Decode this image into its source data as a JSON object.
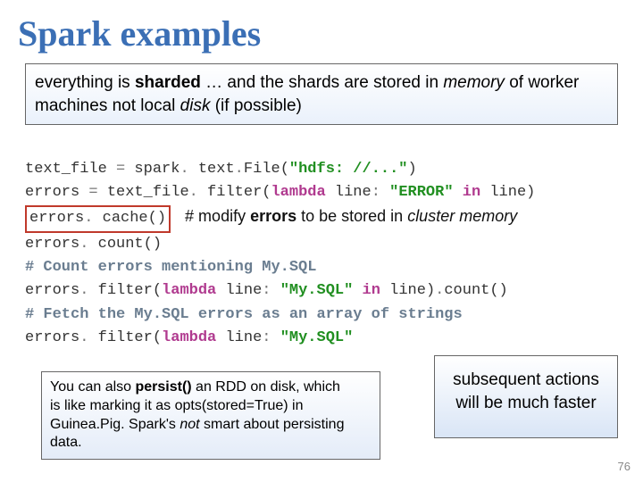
{
  "title": "Spark examples",
  "intro": {
    "pre": "everything is ",
    "sharded": "sharded",
    "mid1": " … and the shards are stored in ",
    "memory": "memory",
    "mid2": " of worker machines not local ",
    "disk": "disk",
    "post": " (if possible)"
  },
  "code": {
    "l1_a": "text_file ",
    "l1_eq": "=",
    "l1_b": " spark",
    "l1_dot1": ".",
    "l1_c": " text",
    "l1_dot2": ".",
    "l1_d": "File",
    "l1_p1": "(",
    "l1_str": "\"hdfs: //...\"",
    "l1_p2": ")",
    "l2_a": "errors ",
    "l2_eq": "=",
    "l2_b": " text_file",
    "l2_dot1": ".",
    "l2_c": " filter",
    "l2_p1": "(",
    "l2_lam": "lambda",
    "l2_d": " line",
    "l2_col": ":",
    "l2_sp": " ",
    "l2_str": "\"ERROR\"",
    "l2_in": " in ",
    "l2_e": "line",
    "l2_p2": ")",
    "l3_a": "errors",
    "l3_dot": ".",
    "l3_b": " cache",
    "l3_p": "()",
    "l4_a": "errors",
    "l4_dot": ".",
    "l4_b": " count",
    "l4_p": "()",
    "l5": "# Count errors mentioning My.SQL",
    "l6_a": "errors",
    "l6_dot1": ".",
    "l6_b": " filter",
    "l6_p1": "(",
    "l6_lam": "lambda",
    "l6_c": " line",
    "l6_col": ":",
    "l6_sp": " ",
    "l6_str": "\"My.SQL\"",
    "l6_in": " in ",
    "l6_d": "line",
    "l6_p2": ")",
    "l6_dot2": ".",
    "l6_e": "count",
    "l6_p3": "()",
    "l7": "# Fetch the My.SQL errors as an array of strings",
    "l8_a": "errors",
    "l8_dot1": ".",
    "l8_b": " filter",
    "l8_p1": "(",
    "l8_lam": "lambda",
    "l8_c": " line",
    "l8_col": ":",
    "l8_sp": " ",
    "l8_str": "\"My.SQL\""
  },
  "inline_annot": {
    "pre": "# modify ",
    "errors": "errors",
    "mid": " to be stored in ",
    "cluster": "cluster memory"
  },
  "persist": {
    "a": "You can also ",
    "persist": "persist()",
    "b": " an RDD on disk, which",
    "c": "is like marking it as opts(stored=True) in Guinea.Pig. Spark's ",
    "not": "not",
    "d": " smart about persisting data."
  },
  "subseq": "subsequent actions will be much faster",
  "page": "76"
}
